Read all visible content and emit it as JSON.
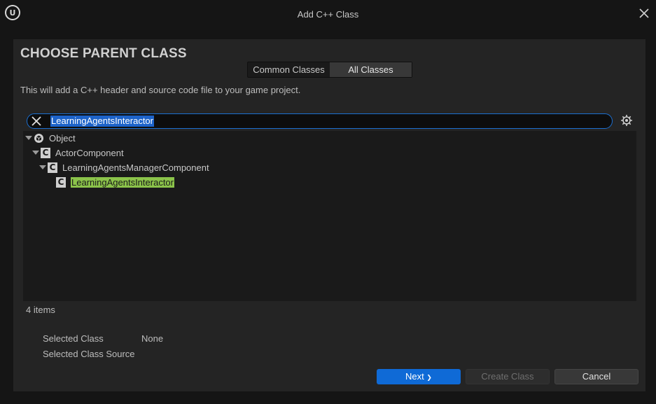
{
  "window": {
    "title": "Add C++ Class",
    "logo": "U"
  },
  "heading": "CHOOSE PARENT CLASS",
  "tabs": {
    "common": "Common Classes",
    "all": "All Classes",
    "active": "All Classes"
  },
  "description": "This will add a C++ header and source code file to your game project.",
  "search": {
    "value": "LearningAgentsInteractor"
  },
  "tree": [
    {
      "label": "Object",
      "icon": "object-icon",
      "expanded": true
    },
    {
      "label": "ActorComponent",
      "icon": "class-icon",
      "expanded": true
    },
    {
      "label": "LearningAgentsManagerComponent",
      "icon": "class-icon",
      "expanded": true
    },
    {
      "label": "LearningAgentsInteractor",
      "icon": "class-icon",
      "highlighted": true
    }
  ],
  "class_icon_glyph": "C",
  "item_count": "4 items",
  "selection": {
    "class_label": "Selected Class",
    "class_value": "None",
    "source_label": "Selected Class Source"
  },
  "buttons": {
    "next": "Next",
    "next_glyph": "❯",
    "create": "Create Class",
    "cancel": "Cancel"
  },
  "colors": {
    "accent": "#0f6ad6",
    "highlight": "#8bc34a",
    "background": "#151515",
    "panel": "#242424"
  }
}
